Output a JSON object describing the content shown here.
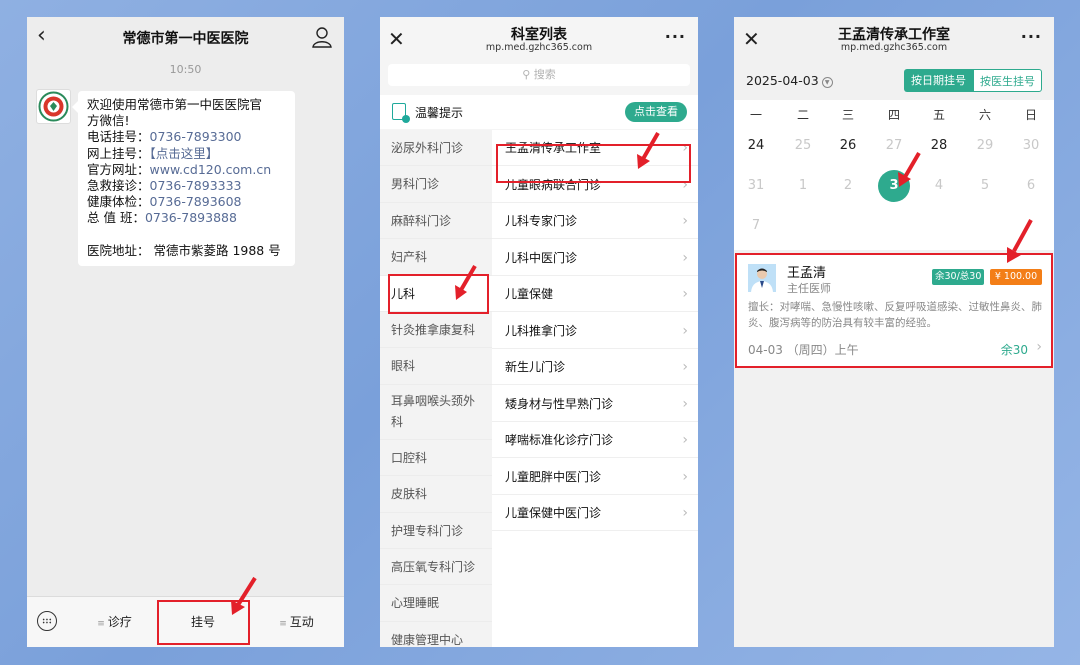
{
  "chat": {
    "title": "常德市第一中医医院",
    "time": "10:50",
    "message": {
      "greeting_1": "欢迎使用常德市第一中医医院官",
      "greeting_2": "方微信!",
      "phone_label": "电话挂号：",
      "phone": "0736-7893300",
      "online_label": "网上挂号：",
      "online_link": "【点击这里】",
      "site_label": "官方网址：",
      "site": "www.cd120.com.cn",
      "emergency_label": "急救接诊：",
      "emergency": "0736-7893333",
      "checkup_label": "健康体检：",
      "checkup": "0736-7893608",
      "duty_label": "总 值 班：",
      "duty": "0736-7893888",
      "address": "医院地址：   常德市紫菱路 1988 号"
    },
    "menu": [
      "诊疗",
      "挂号",
      "互动"
    ]
  },
  "dept_list": {
    "title": "科室列表",
    "url": "mp.med.gzhc365.com",
    "more": "···",
    "search_placeholder": "搜索",
    "tip_text": "温馨提示",
    "tip_button": "点击查看",
    "departments": [
      "泌尿外科门诊",
      "男科门诊",
      "麻醉科门诊",
      "妇产科",
      "儿科",
      "针灸推拿康复科",
      "眼科",
      "耳鼻咽喉头颈外科",
      "口腔科",
      "皮肤科",
      "护理专科门诊",
      "高压氧专科门诊",
      "心理睡眠",
      "健康管理中心"
    ],
    "selected_department": "儿科",
    "clinics": [
      "王孟清传承工作室",
      "儿童眼病联合门诊",
      "儿科专家门诊",
      "儿科中医门诊",
      "儿童保健",
      "儿科推拿门诊",
      "新生儿门诊",
      "矮身材与性早熟门诊",
      "哮喘标准化诊疗门诊",
      "儿童肥胖中医门诊",
      "儿童保健中医门诊"
    ]
  },
  "schedule": {
    "title": "王孟清传承工作室",
    "url": "mp.med.gzhc365.com",
    "more": "···",
    "date": "2025-04-03",
    "mode_by_date": "按日期挂号",
    "mode_by_doctor": "按医生挂号",
    "weekdays": [
      "一",
      "二",
      "三",
      "四",
      "五",
      "六",
      "日"
    ],
    "days": [
      {
        "label": "24",
        "state": "on"
      },
      {
        "label": "25",
        "state": "off"
      },
      {
        "label": "26",
        "state": "on"
      },
      {
        "label": "27",
        "state": "off"
      },
      {
        "label": "28",
        "state": "on"
      },
      {
        "label": "29",
        "state": "off"
      },
      {
        "label": "30",
        "state": "off"
      },
      {
        "label": "31",
        "state": "off"
      },
      {
        "label": "1",
        "state": "off"
      },
      {
        "label": "2",
        "state": "off"
      },
      {
        "label": "3",
        "state": "selected"
      },
      {
        "label": "4",
        "state": "off"
      },
      {
        "label": "5",
        "state": "off"
      },
      {
        "label": "6",
        "state": "off"
      },
      {
        "label": "7",
        "state": "off"
      }
    ],
    "doctor": {
      "name": "王孟清",
      "title": "主任医师",
      "availability": "余30/总30",
      "price": "¥ 100.00",
      "description": "擅长：对哮喘、急慢性咳嗽、反复呼吸道感染、过敏性鼻炎、肺炎、腹泻病等的防治具有较丰富的经验。",
      "slot": "04-03  （周四）上午",
      "remaining": "余30"
    }
  },
  "colors": {
    "accent": "#2eaa8e",
    "price": "#f37e17",
    "highlight": "#e3202a",
    "link": "#576b95"
  }
}
